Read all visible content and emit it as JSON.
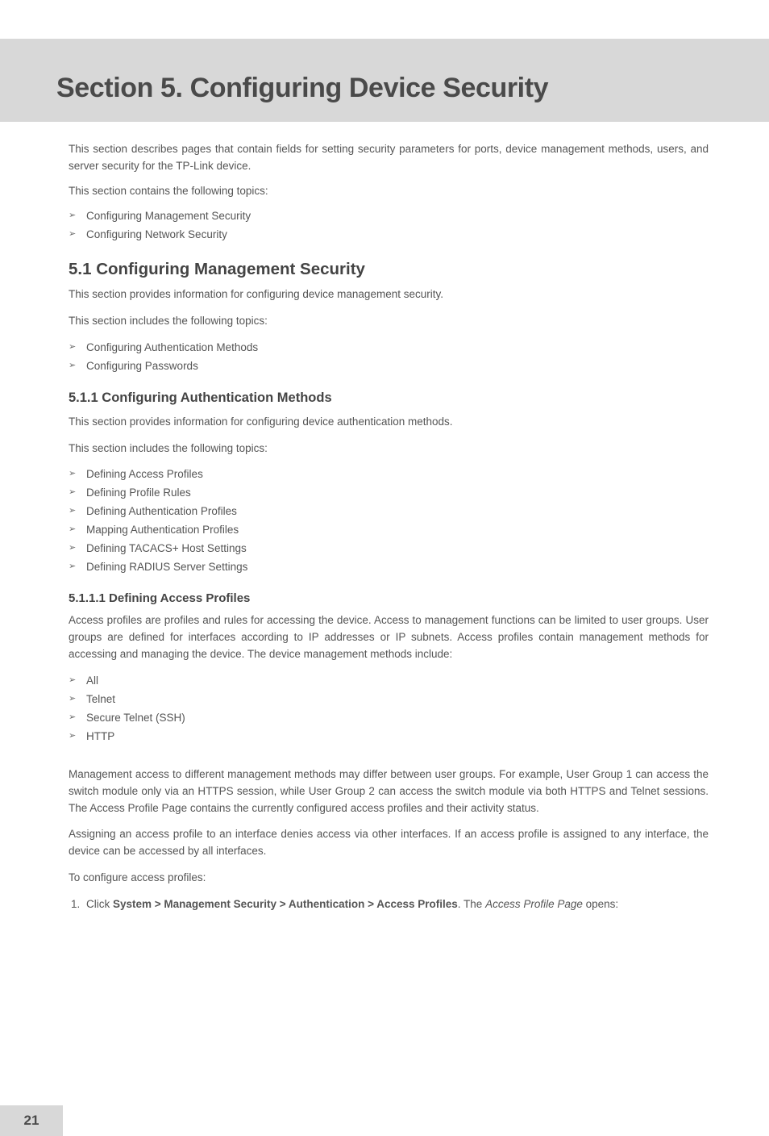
{
  "header": {
    "title": "Section 5.  Configuring Device Security"
  },
  "intro": {
    "p1": "This section describes pages that contain fields for setting security parameters for ports, device management methods, users, and server security for the TP-Link device.",
    "p2": "This section contains the following topics:",
    "items": {
      "0": "Configuring Management Security",
      "1": "Configuring Network Security"
    }
  },
  "s51": {
    "title": "5.1   Configuring Management Security",
    "p1": "This section provides information for configuring device management security.",
    "p2": "This section includes the following topics:",
    "items": {
      "0": "Configuring Authentication Methods",
      "1": "Configuring Passwords"
    }
  },
  "s511": {
    "title": "5.1.1   Configuring Authentication Methods",
    "p1": "This section provides information for configuring device authentication methods.",
    "p2": "This section includes the following topics:",
    "items": {
      "0": "Defining Access Profiles",
      "1": "Defining Profile Rules",
      "2": "Defining Authentication Profiles",
      "3": "Mapping Authentication Profiles",
      "4": "Defining TACACS+ Host Settings",
      "5": "Defining RADIUS Server Settings"
    }
  },
  "s5111": {
    "title": "5.1.1.1  Defining Access Profiles",
    "p1": "Access profiles are profiles and rules for accessing the device. Access to management functions can be limited to user groups. User groups are defined for interfaces according to IP addresses or IP subnets. Access profiles contain management methods for accessing and managing the device. The device management methods include:",
    "items": {
      "0": "All",
      "1": "Telnet",
      "2": "Secure Telnet (SSH)",
      "3": "HTTP"
    },
    "p2": "Management access to different management methods may differ between user groups. For example, User Group 1 can access the switch module only via an HTTPS session, while User Group 2 can access the switch module via both HTTPS and Telnet sessions. The Access Profile Page contains the currently configured access profiles and their activity status.",
    "p3": "Assigning an access profile to an interface denies access via other interfaces. If an access profile is assigned to any interface, the device can be accessed by all interfaces.",
    "p4": "To configure access profiles:",
    "step1_pre": "Click ",
    "step1_bold": "System > Management Security > Authentication > Access Profiles",
    "step1_mid": ". The ",
    "step1_ital": "Access Profile Page",
    "step1_post": " opens:"
  },
  "page_number": "21"
}
